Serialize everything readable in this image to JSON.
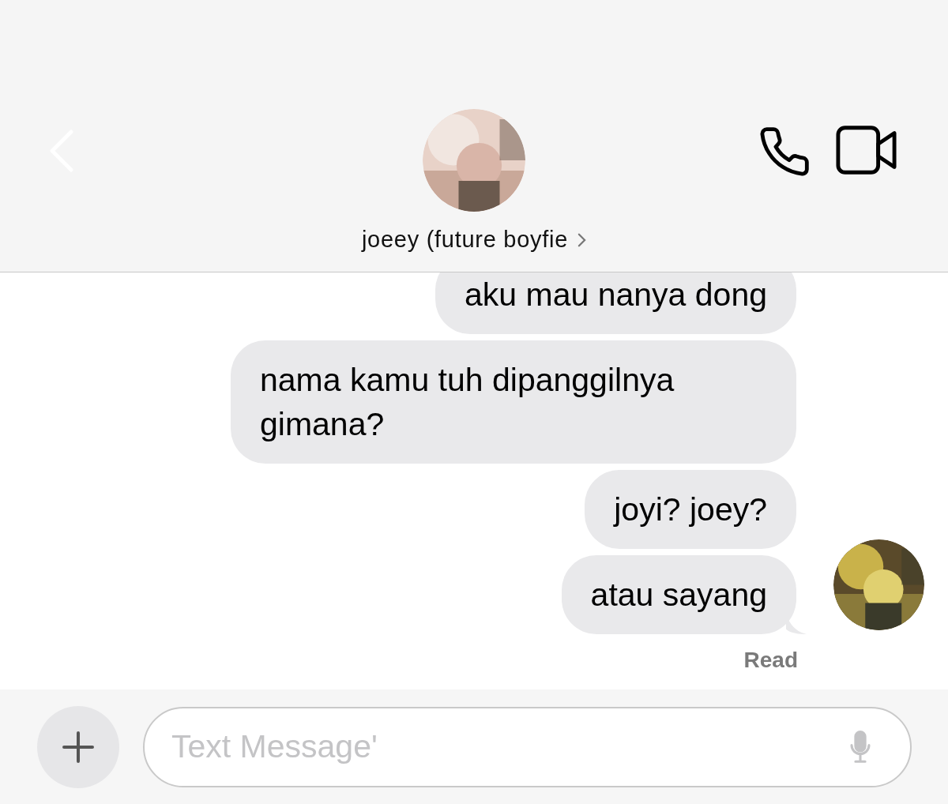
{
  "header": {
    "contact_name": "joeey (future boyfie"
  },
  "messages": [
    {
      "text": "aku mau nanya dong",
      "tail": false
    },
    {
      "text": "nama kamu tuh dipanggilnya gimana?",
      "tail": false
    },
    {
      "text": "joyi? joey?",
      "tail": false
    },
    {
      "text": "atau sayang",
      "tail": true
    }
  ],
  "receipt": "Read",
  "composer": {
    "placeholder": "Text Message'"
  }
}
